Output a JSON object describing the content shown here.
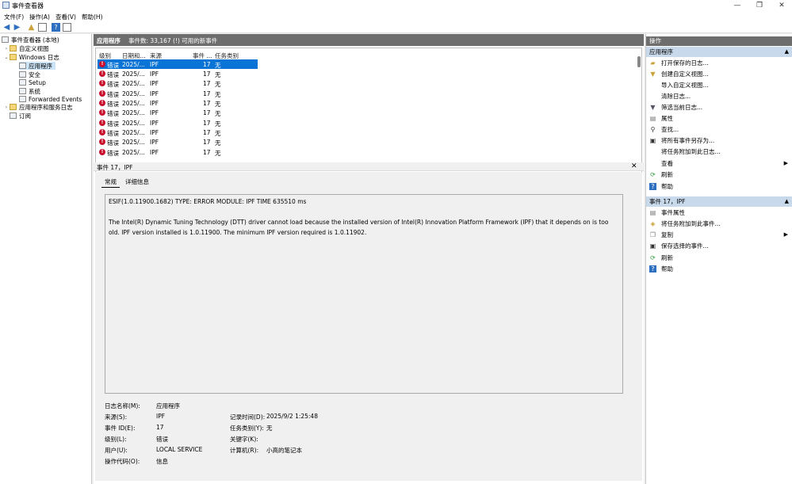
{
  "window": {
    "title": "事件查看器",
    "minimize": "—",
    "maximize": "❐",
    "close": "✕"
  },
  "menu": [
    "文件(F)",
    "操作(A)",
    "查看(V)",
    "帮助(H)"
  ],
  "tree": {
    "root": "事件查看器 (本地)",
    "custom_views": "自定义视图",
    "windows_logs": "Windows 日志",
    "application": "应用程序",
    "security": "安全",
    "setup": "Setup",
    "system": "系统",
    "forwarded": "Forwarded Events",
    "app_services": "应用程序和服务日志",
    "subscriptions": "订阅"
  },
  "center": {
    "header_name": "应用程序",
    "header_count": "事件数: 33,167 (!) 可用的新事件",
    "columns": [
      "级别",
      "日期和...",
      "来源",
      "事件 ...",
      "任务类别"
    ],
    "rows": [
      {
        "level": "错误",
        "date": "2025/...",
        "source": "IPF",
        "id": "17",
        "task": "无"
      },
      {
        "level": "错误",
        "date": "2025/...",
        "source": "IPF",
        "id": "17",
        "task": "无"
      },
      {
        "level": "错误",
        "date": "2025/...",
        "source": "IPF",
        "id": "17",
        "task": "无"
      },
      {
        "level": "错误",
        "date": "2025/...",
        "source": "IPF",
        "id": "17",
        "task": "无"
      },
      {
        "level": "错误",
        "date": "2025/...",
        "source": "IPF",
        "id": "17",
        "task": "无"
      },
      {
        "level": "错误",
        "date": "2025/...",
        "source": "IPF",
        "id": "17",
        "task": "无"
      },
      {
        "level": "错误",
        "date": "2025/...",
        "source": "IPF",
        "id": "17",
        "task": "无"
      },
      {
        "level": "错误",
        "date": "2025/...",
        "source": "IPF",
        "id": "17",
        "task": "无"
      },
      {
        "level": "错误",
        "date": "2025/...",
        "source": "IPF",
        "id": "17",
        "task": "无"
      },
      {
        "level": "错误",
        "date": "2025/...",
        "source": "IPF",
        "id": "17",
        "task": "无"
      }
    ]
  },
  "detail": {
    "title": "事件 17，IPF",
    "tab_general": "常规",
    "tab_details": "详细信息",
    "msg_line1": "ESIF(1.0.11900.1682) TYPE: ERROR MODULE: IPF TIME 635510 ms",
    "msg_line2": "The Intel(R) Dynamic Tuning Technology (DTT) driver cannot load because the installed version of Intel(R) Innovation Platform Framework (IPF) that it depends on is too old.  IPF version installed is 1.0.11900.  The minimum IPF version required is 1.0.11902.",
    "log_name_label": "日志名称(M):",
    "log_name": "应用程序",
    "source_label": "来源(S):",
    "source": "IPF",
    "logged_label": "记录时间(D):",
    "logged": "2025/9/2 1:25:48",
    "event_id_label": "事件 ID(E):",
    "event_id": "17",
    "task_label": "任务类别(Y):",
    "task": "无",
    "level_label": "级别(L):",
    "level": "错误",
    "keywords_label": "关键字(K):",
    "user_label": "用户(U):",
    "user": "LOCAL SERVICE",
    "computer_label": "计算机(R):",
    "computer": "小高的笔记本",
    "opcode_label": "操作代码(O):",
    "opcode": "信息"
  },
  "actions": {
    "header": "操作",
    "section1": "应用程序",
    "items1": [
      "打开保存的日志...",
      "创建自定义视图...",
      "导入自定义视图...",
      "清除日志...",
      "筛选当前日志...",
      "属性",
      "查找...",
      "将所有事件另存为...",
      "将任务附加到此日志...",
      "查看",
      "刷新",
      "帮助"
    ],
    "section2": "事件 17，IPF",
    "items2": [
      "事件属性",
      "将任务附加到此事件...",
      "复制",
      "保存选择的事件...",
      "刷新",
      "帮助"
    ]
  }
}
